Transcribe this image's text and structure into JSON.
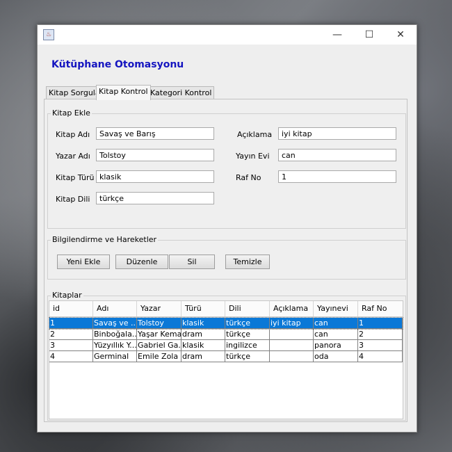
{
  "window": {
    "icon": "java-icon",
    "controls": {
      "minimize": "—",
      "maximize": "☐",
      "close": "✕"
    }
  },
  "app": {
    "title": "Kütüphane Otomasyonu"
  },
  "tabs": [
    "Kitap Sorgula",
    "Kitap Kontrol",
    "Kategori Kontrol"
  ],
  "book_form": {
    "group_title": "Kitap Ekle",
    "fields": {
      "kitap_adi": {
        "label": "Kitap Adı",
        "value": "Savaş ve Barış"
      },
      "yazar_adi": {
        "label": "Yazar Adı",
        "value": "Tolstoy"
      },
      "kitap_turu": {
        "label": "Kitap Türü",
        "value": "klasik"
      },
      "kitap_dili": {
        "label": "Kitap Dili",
        "value": "türkçe"
      },
      "aciklama": {
        "label": "Açıklama",
        "value": "iyi kitap"
      },
      "yayin_evi": {
        "label": "Yayın Evi",
        "value": "can"
      },
      "raf_no": {
        "label": "Raf No",
        "value": "1"
      }
    }
  },
  "actions": {
    "group_title": "Bilgilendirme ve Hareketler",
    "buttons": [
      "Yeni Ekle",
      "Düzenle",
      "Sil",
      "Temizle"
    ]
  },
  "books_table": {
    "group_title": "Kitaplar",
    "columns": [
      "id",
      "Adı",
      "Yazar",
      "Türü",
      "Dili",
      "Açıklama",
      "Yayınevi",
      "Raf No"
    ],
    "rows": [
      [
        "1",
        "Savaş ve ...",
        "Tolstoy",
        "klasik",
        "türkçe",
        "iyi kitap",
        "can",
        "1"
      ],
      [
        "2",
        "Binboğala...",
        "Yaşar Kemal",
        "dram",
        "türkçe",
        "",
        "can",
        "2"
      ],
      [
        "3",
        "Yüzyıllık Y...",
        "Gabriel Ga...",
        "klasik",
        "ingilizce",
        "",
        "panora",
        "3"
      ],
      [
        "4",
        "Germinal",
        "Emile Zola",
        "dram",
        "türkçe",
        "",
        "oda",
        "4"
      ]
    ],
    "selected_row": 0
  },
  "colors": {
    "title": "#1515c0",
    "selection": "#0a78d7"
  }
}
